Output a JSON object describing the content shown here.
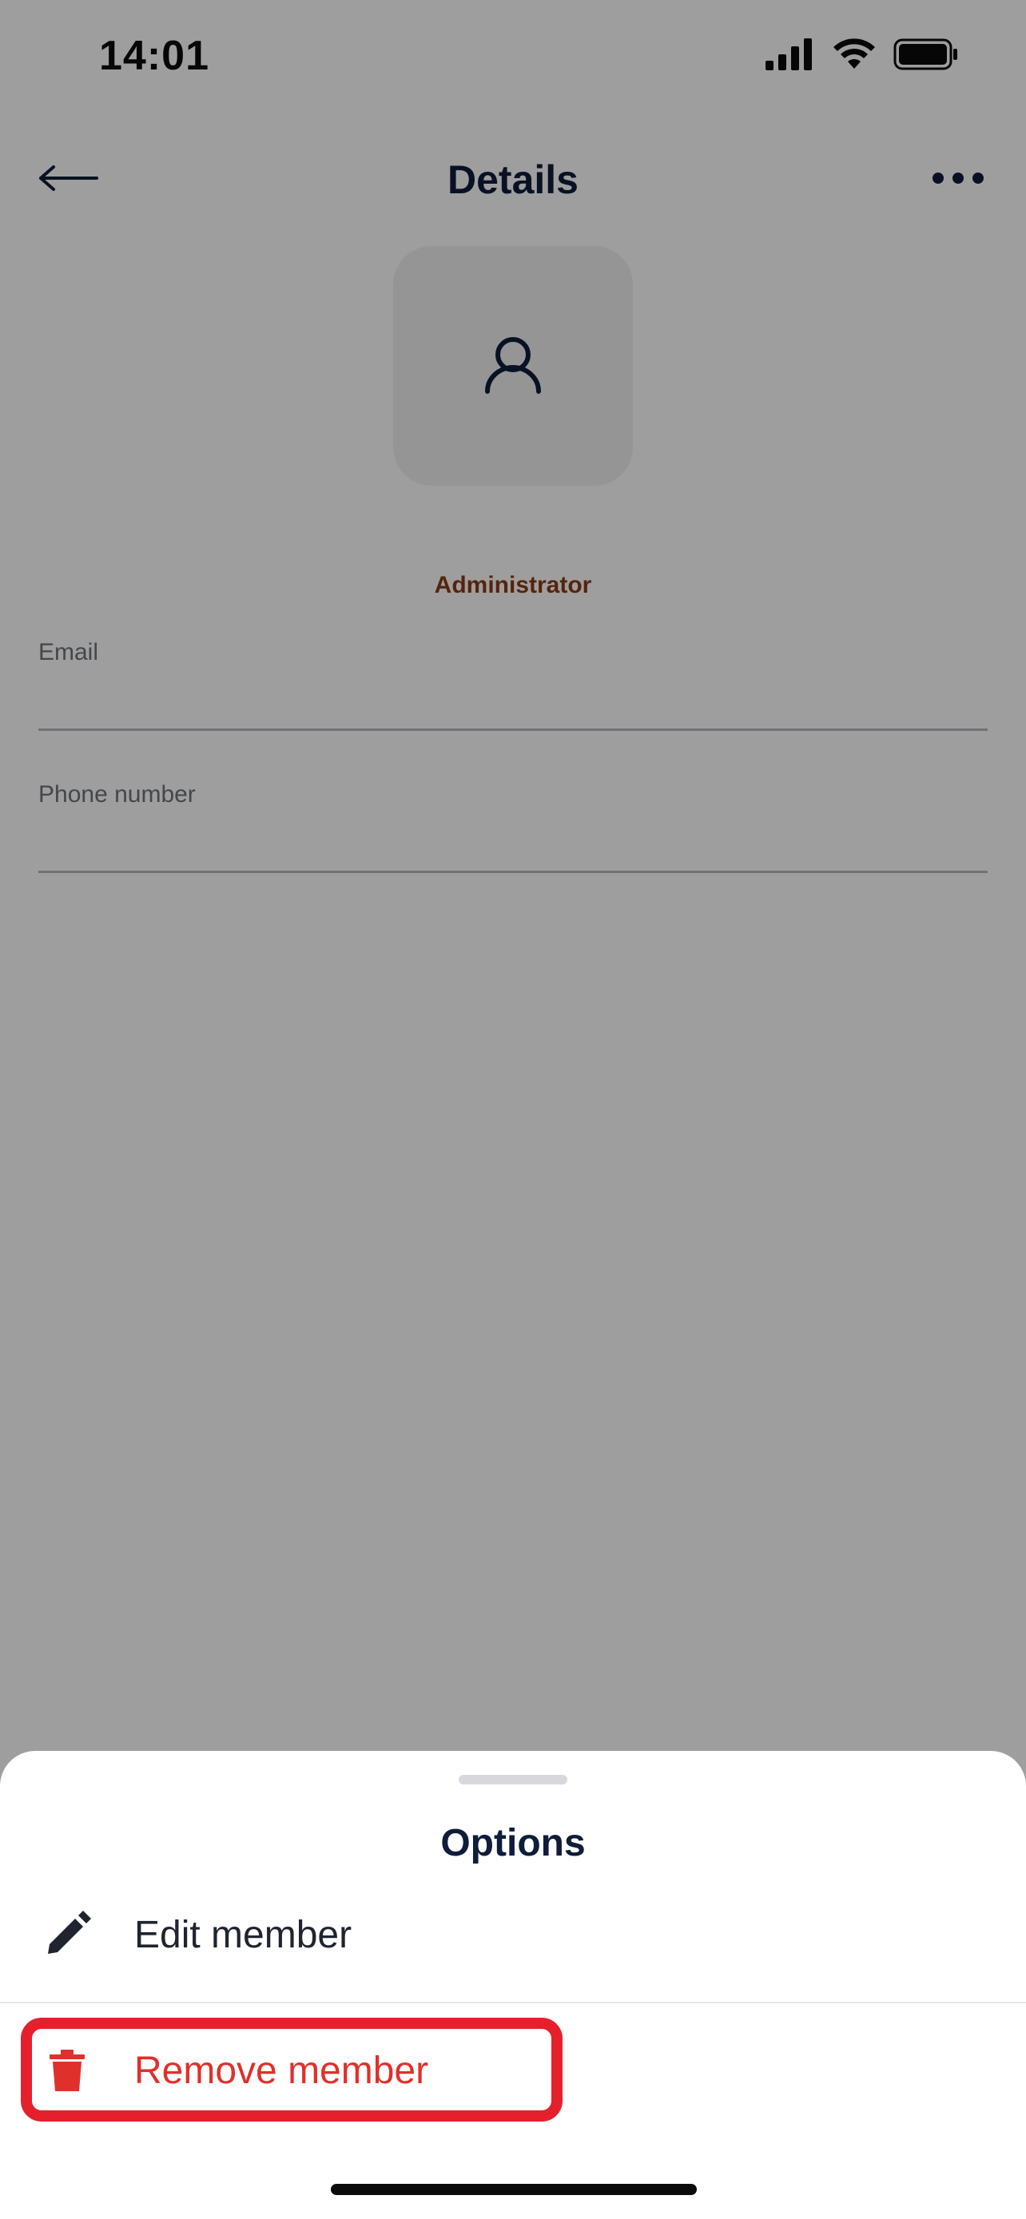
{
  "status_bar": {
    "time": "14:01",
    "icons": [
      "signal-icon",
      "wifi-icon",
      "battery-icon"
    ]
  },
  "header": {
    "title": "Details",
    "back_icon": "arrow-left-icon",
    "more_icon": "more-horizontal-icon"
  },
  "profile": {
    "avatar_icon": "user-icon",
    "role": "Administrator"
  },
  "fields": {
    "email_label": "Email",
    "email_value": "",
    "phone_label": "Phone number",
    "phone_value": ""
  },
  "sheet": {
    "title": "Options",
    "items": [
      {
        "label": "Edit member",
        "icon": "pencil-icon",
        "color": "#1f2430"
      },
      {
        "label": "Remove member",
        "icon": "trash-icon",
        "color": "#e0302b"
      }
    ]
  },
  "colors": {
    "primary_text": "#0f1d3a",
    "role_text": "#8a3a18",
    "danger": "#e0302b",
    "highlight": "#e5202d"
  }
}
